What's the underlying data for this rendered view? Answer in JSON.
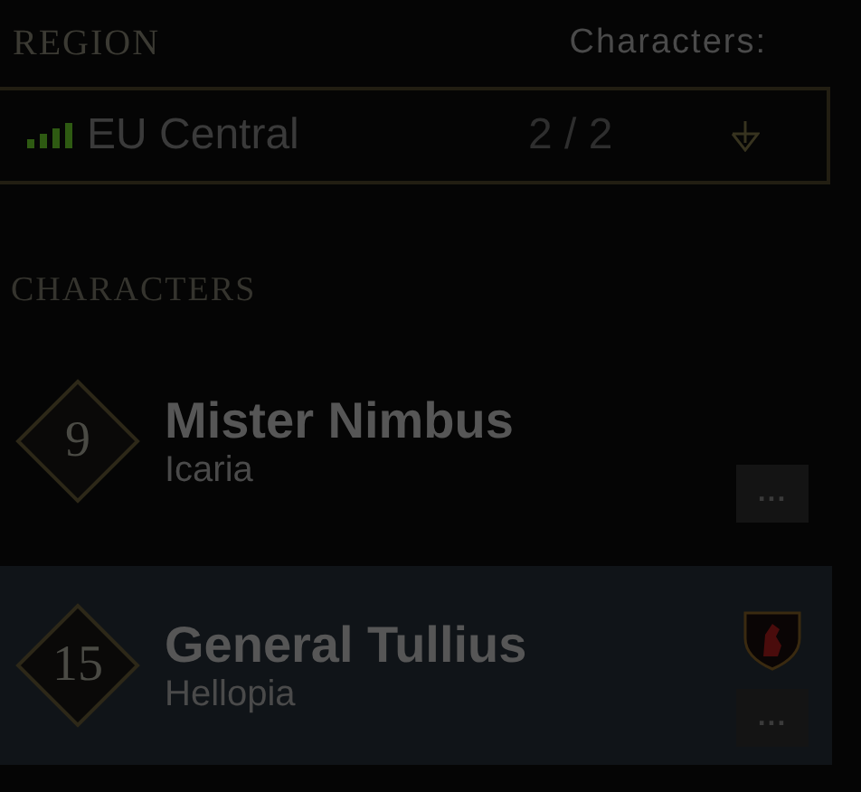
{
  "region": {
    "label": "REGION",
    "characters_label": "Characters:",
    "server": "EU Central",
    "count": "2 / 2"
  },
  "characters_heading": "CHARACTERS",
  "characters": [
    {
      "level": "9",
      "name": "Mister Nimbus",
      "world": "Icaria",
      "selected": false,
      "faction_badge": false,
      "menu": "..."
    },
    {
      "level": "15",
      "name": "General Tullius",
      "world": "Hellopia",
      "selected": true,
      "faction_badge": true,
      "menu": "..."
    }
  ]
}
